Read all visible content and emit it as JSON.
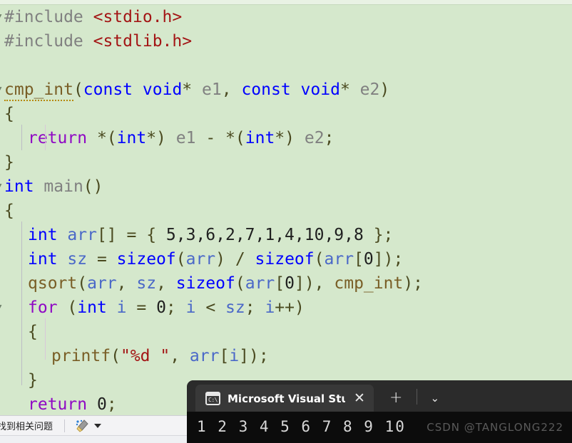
{
  "editor": {
    "background_color": "#d5e8cc",
    "lines": [
      {
        "indent": 0,
        "fold": true,
        "tokens": [
          {
            "t": "#include ",
            "c": "pre"
          },
          {
            "t": "<stdio.h>",
            "c": "str"
          }
        ]
      },
      {
        "indent": 0,
        "fold": false,
        "tokens": [
          {
            "t": "#include ",
            "c": "pre"
          },
          {
            "t": "<stdlib.h>",
            "c": "str"
          }
        ]
      },
      {
        "indent": 0,
        "fold": false,
        "tokens": []
      },
      {
        "indent": 0,
        "fold": true,
        "tokens": [
          {
            "t": "cmp_int",
            "c": "fn",
            "squiggle": true
          },
          {
            "t": "(",
            "c": "op"
          },
          {
            "t": "const",
            "c": "kw"
          },
          {
            "t": " ",
            "c": "plain"
          },
          {
            "t": "void",
            "c": "kw"
          },
          {
            "t": "*",
            "c": "op"
          },
          {
            "t": " ",
            "c": "plain"
          },
          {
            "t": "e1",
            "c": "var"
          },
          {
            "t": ",",
            "c": "op"
          },
          {
            "t": " ",
            "c": "plain"
          },
          {
            "t": "const",
            "c": "kw"
          },
          {
            "t": " ",
            "c": "plain"
          },
          {
            "t": "void",
            "c": "kw"
          },
          {
            "t": "*",
            "c": "op"
          },
          {
            "t": " ",
            "c": "plain"
          },
          {
            "t": "e2",
            "c": "var"
          },
          {
            "t": ")",
            "c": "op"
          }
        ]
      },
      {
        "indent": 0,
        "fold": false,
        "tokens": [
          {
            "t": "{",
            "c": "op"
          }
        ]
      },
      {
        "indent": 1,
        "fold": false,
        "tokens": [
          {
            "t": "return",
            "c": "ctl"
          },
          {
            "t": " ",
            "c": "plain"
          },
          {
            "t": "*(",
            "c": "op"
          },
          {
            "t": "int",
            "c": "kw"
          },
          {
            "t": "*)",
            "c": "op"
          },
          {
            "t": " ",
            "c": "plain"
          },
          {
            "t": "e1",
            "c": "var"
          },
          {
            "t": " ",
            "c": "plain"
          },
          {
            "t": "-",
            "c": "op"
          },
          {
            "t": " ",
            "c": "plain"
          },
          {
            "t": "*(",
            "c": "op"
          },
          {
            "t": "int",
            "c": "kw"
          },
          {
            "t": "*)",
            "c": "op"
          },
          {
            "t": " ",
            "c": "plain"
          },
          {
            "t": "e2",
            "c": "var"
          },
          {
            "t": ";",
            "c": "op"
          }
        ]
      },
      {
        "indent": 0,
        "fold": false,
        "tokens": [
          {
            "t": "}",
            "c": "op"
          }
        ]
      },
      {
        "indent": 0,
        "fold": true,
        "tokens": [
          {
            "t": "int",
            "c": "kw"
          },
          {
            "t": " ",
            "c": "plain"
          },
          {
            "t": "main",
            "c": "var"
          },
          {
            "t": "()",
            "c": "op"
          }
        ]
      },
      {
        "indent": 0,
        "fold": false,
        "tokens": [
          {
            "t": "{",
            "c": "op"
          }
        ]
      },
      {
        "indent": 1,
        "fold": false,
        "tokens": [
          {
            "t": "int",
            "c": "kw"
          },
          {
            "t": " ",
            "c": "plain"
          },
          {
            "t": "arr",
            "c": "varb"
          },
          {
            "t": "[] = { ",
            "c": "op"
          },
          {
            "t": "5,3,6,2,7,1,4,10,9,8",
            "c": "num"
          },
          {
            "t": " };",
            "c": "op"
          }
        ]
      },
      {
        "indent": 1,
        "fold": false,
        "tokens": [
          {
            "t": "int",
            "c": "kw"
          },
          {
            "t": " ",
            "c": "plain"
          },
          {
            "t": "sz",
            "c": "varb"
          },
          {
            "t": " = ",
            "c": "op"
          },
          {
            "t": "sizeof",
            "c": "kw"
          },
          {
            "t": "(",
            "c": "op"
          },
          {
            "t": "arr",
            "c": "varb"
          },
          {
            "t": ") / ",
            "c": "op"
          },
          {
            "t": "sizeof",
            "c": "kw"
          },
          {
            "t": "(",
            "c": "op"
          },
          {
            "t": "arr",
            "c": "varb"
          },
          {
            "t": "[",
            "c": "op"
          },
          {
            "t": "0",
            "c": "num"
          },
          {
            "t": "]);",
            "c": "op"
          }
        ]
      },
      {
        "indent": 1,
        "fold": false,
        "tokens": [
          {
            "t": "qsort",
            "c": "fn"
          },
          {
            "t": "(",
            "c": "op"
          },
          {
            "t": "arr",
            "c": "varb"
          },
          {
            "t": ", ",
            "c": "op"
          },
          {
            "t": "sz",
            "c": "varb"
          },
          {
            "t": ", ",
            "c": "op"
          },
          {
            "t": "sizeof",
            "c": "kw"
          },
          {
            "t": "(",
            "c": "op"
          },
          {
            "t": "arr",
            "c": "varb"
          },
          {
            "t": "[",
            "c": "op"
          },
          {
            "t": "0",
            "c": "num"
          },
          {
            "t": "]), ",
            "c": "op"
          },
          {
            "t": "cmp_int",
            "c": "fn"
          },
          {
            "t": ");",
            "c": "op"
          }
        ]
      },
      {
        "indent": 1,
        "fold": true,
        "tokens": [
          {
            "t": "for",
            "c": "ctl"
          },
          {
            "t": " (",
            "c": "op"
          },
          {
            "t": "int",
            "c": "kw"
          },
          {
            "t": " ",
            "c": "plain"
          },
          {
            "t": "i",
            "c": "varb"
          },
          {
            "t": " = ",
            "c": "op"
          },
          {
            "t": "0",
            "c": "num"
          },
          {
            "t": "; ",
            "c": "op"
          },
          {
            "t": "i",
            "c": "varb"
          },
          {
            "t": " < ",
            "c": "op"
          },
          {
            "t": "sz",
            "c": "varb"
          },
          {
            "t": "; ",
            "c": "op"
          },
          {
            "t": "i",
            "c": "varb"
          },
          {
            "t": "++)",
            "c": "op"
          }
        ]
      },
      {
        "indent": 1,
        "fold": false,
        "tokens": [
          {
            "t": "{",
            "c": "op"
          }
        ]
      },
      {
        "indent": 2,
        "fold": false,
        "tokens": [
          {
            "t": "printf",
            "c": "fn"
          },
          {
            "t": "(",
            "c": "op"
          },
          {
            "t": "\"%d \"",
            "c": "str"
          },
          {
            "t": ", ",
            "c": "op"
          },
          {
            "t": "arr",
            "c": "varb"
          },
          {
            "t": "[",
            "c": "op"
          },
          {
            "t": "i",
            "c": "varb"
          },
          {
            "t": "]);",
            "c": "op"
          }
        ]
      },
      {
        "indent": 1,
        "fold": false,
        "tokens": [
          {
            "t": "}",
            "c": "op"
          }
        ]
      },
      {
        "indent": 1,
        "fold": false,
        "tokens": [
          {
            "t": "return",
            "c": "ctl"
          },
          {
            "t": " ",
            "c": "plain"
          },
          {
            "t": "0",
            "c": "num"
          },
          {
            "t": ";",
            "c": "op"
          }
        ]
      },
      {
        "indent": 0,
        "fold": false,
        "tokens": [
          {
            "t": "}",
            "c": "op"
          }
        ]
      }
    ]
  },
  "statusbar": {
    "message": "找到相关问题",
    "broom_icon": "broom-icon",
    "dropdown_icon": "chevron-down-icon"
  },
  "terminal": {
    "tab": {
      "icon": "console-cmd-icon",
      "icon_text": "C:\\",
      "title": "Microsoft Visual Studio 调试控",
      "close_icon": "close-icon"
    },
    "new_tab_icon": "plus-icon",
    "dropdown_icon": "chevron-down-icon",
    "output": "1 2 3 4 5 6 7 8 9 10",
    "watermark": "CSDN @TANGLONG222",
    "background_color": "#0c0c0c",
    "tabbar_color": "#2b2b2b"
  }
}
